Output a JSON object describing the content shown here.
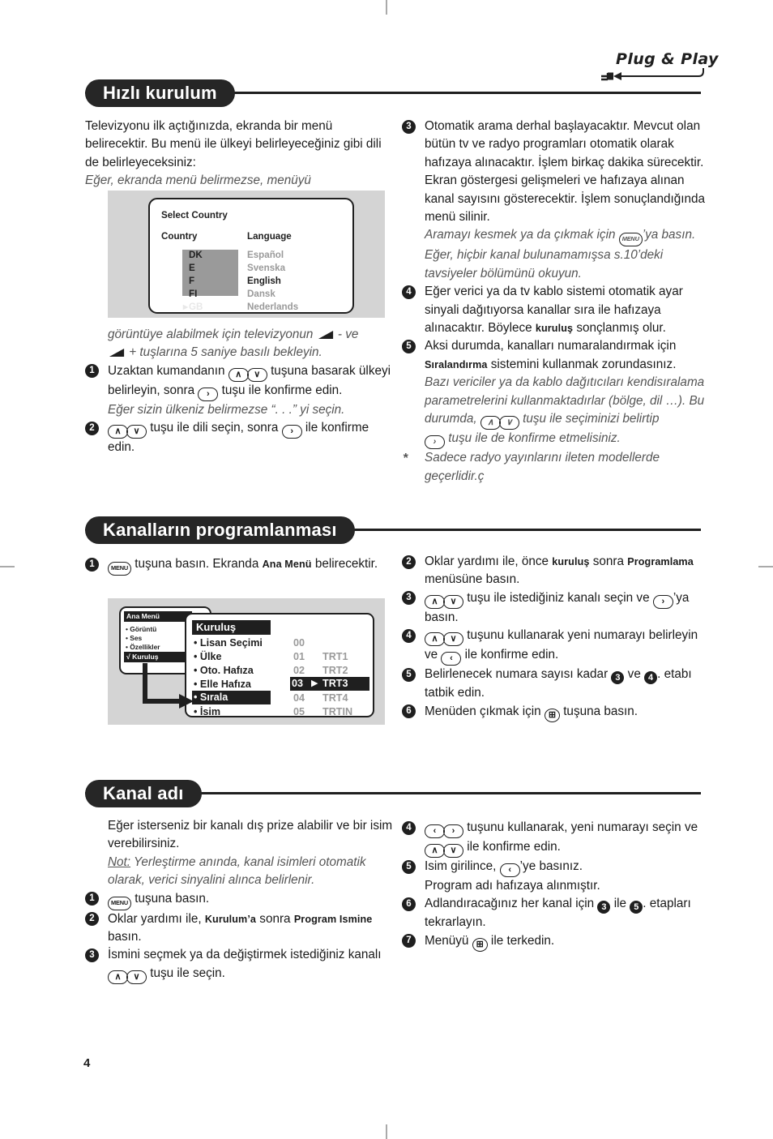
{
  "logo": {
    "text": "Plug & Play"
  },
  "page_number": "4",
  "sections": {
    "quick_install": {
      "title": "Hızlı kurulum",
      "left": {
        "intro": "Televizyonu ilk açtığınızda, ekranda bir menü belirecektir. Bu menü ile ülkeyi belirleyeceğiniz gibi dili de belirleyeceksiniz:",
        "intro_italic": "Eğer, ekranda menü belirmezse, menüyü",
        "after_shot_italic_1": "görüntüye alabilmek için televizyonun",
        "after_shot_italic_1b": "- ve",
        "after_shot_italic_2": "+ tuşlarına 5 saniye basılı bekleyin.",
        "step1_a": "Uzaktan kumandanın",
        "step1_b": "tuşuna basarak ülkeyi belirleyin, sonra",
        "step1_c": "tuşu ile konfirme edin.",
        "step1_note": "Eğer sizin ülkeniz belirmezse “. . .” yi seçin.",
        "step2_a": "tuşu ile dili seçin, sonra",
        "step2_b": "ile konfirme edin."
      },
      "osd_select_country": {
        "title": "Select Country",
        "col_country": "Country",
        "col_language": "Language",
        "countries": [
          "DK",
          "E",
          "F",
          "FI",
          "GB"
        ],
        "selected_country": "GB",
        "languages": [
          "Español",
          "Svenska",
          "English",
          "Dansk",
          "Nederlands"
        ],
        "selected_language": "English"
      },
      "right": {
        "step3_text": "Otomatik arama derhal başlayacaktır. Mevcut olan bütün tv ve radyo programları otomatik olarak hafızaya alınacaktır. İşlem birkaç dakika sürecektir. Ekran göstergesi gelişmeleri ve hafızaya alınan kanal sayısını gösterecektir. İşlem sonuçlandığında menü silinir.",
        "step3_note_a": "Aramayı kesmek ya da çıkmak için",
        "step3_note_b": "’ya basın. Eğer, hiçbir kanal bulunamamışsa s.10’deki tavsiyeler bölümünü okuyun.",
        "step4_a": "Eğer verici ya da tv kablo sistemi otomatik ayar sinyali dağıtıyorsa kanallar sıra ile hafızaya alınacaktır. Böylece",
        "step4_bold": "kuruluş",
        "step4_b": "sonçlanmış olur.",
        "step5_a": "Aksi durumda, kanalları numaralandırmak için",
        "step5_bold": "Sıralandırma",
        "step5_b": "sistemini kullanmak zorundasınız.",
        "step5_note_a": "Bazı vericiler ya da kablo dağıtıcıları kendisıralama parametrelerini kullanmaktadırlar (bölge, dil …). Bu durumda,",
        "step5_note_b": "tuşu ile seçiminizi belirtip",
        "step5_note_c": "tuşu ile de konfirme etmelisiniz.",
        "footnote_mark": "*",
        "footnote": "Sadece radyo yayınlarını ileten modellerde geçerlidir.ç"
      }
    },
    "channel_programming": {
      "title": "Kanalların programlanması",
      "left": {
        "step1_a": "tuşuna basın. Ekranda",
        "step1_bold": "Ana Menü",
        "step1_b": "belirecektir."
      },
      "osd_main_menu": {
        "title": "Ana Menü",
        "items": [
          "Görüntü",
          "Ses",
          "Özellikler"
        ],
        "selected": "Kuruluş",
        "selected_prefix": "√"
      },
      "osd_setup": {
        "title": "Kuruluş",
        "items": [
          "Lisan Seçimi",
          "Ülke",
          "Oto. Hafıza",
          "Elle Hafıza",
          "Sırala",
          "İsim"
        ],
        "highlighted": "Sırala",
        "channels": [
          {
            "num": "00",
            "name": ""
          },
          {
            "num": "01",
            "name": "TRT1"
          },
          {
            "num": "02",
            "name": "TRT2"
          },
          {
            "num": "03",
            "name": "TRT3"
          },
          {
            "num": "04",
            "name": "TRT4"
          },
          {
            "num": "05",
            "name": "TRTIN"
          }
        ],
        "highlighted_channel": "03"
      },
      "right": {
        "step2_a": "Oklar yardımı ile, önce",
        "step2_bold1": "kuruluş",
        "step2_b": "sonra",
        "step2_bold2": "Programlama",
        "step2_c": "menüsüne basın.",
        "step3_a": "tuşu ile istediğiniz kanalı seçin ve",
        "step3_b": "’ya basın.",
        "step4_a": "tuşunu kullanarak yeni numarayı belirleyin ve",
        "step4_b": "ile konfirme edin.",
        "step5_a": "Belirlenecek numara sayısı kadar",
        "step5_mid": "ve",
        "step5_b": ". etabı tatbik edin.",
        "step6_a": "Menüden çıkmak için",
        "step6_b": "tuşuna basın."
      }
    },
    "channel_name": {
      "title": "Kanal adı",
      "left": {
        "intro": "Eğer isterseniz bir kanalı dış prize alabilir ve bir isim verebilirsiniz.",
        "note_label": "Not:",
        "note_text": "Yerleştirme anında, kanal isimleri otomatik olarak, verici sinyalini alınca belirlenir.",
        "step1": "tuşuna basın.",
        "step2_a": "Oklar yardımı ile,",
        "step2_bold1": "Kurulum’a",
        "step2_b": "sonra",
        "step2_bold2": "Program Ismine",
        "step2_c": "basın.",
        "step3_a": "İsmini seçmek ya da değiştirmek istediğiniz kanalı",
        "step3_b": "tuşu ile seçin."
      },
      "right": {
        "step4_a": "tuşunu kullanarak, yeni numarayı seçin ve",
        "step4_b": "ile konfirme edin.",
        "step5_a": "Isim girilince,",
        "step5_b": "’ye basınız.",
        "step5_c": "Program adı hafızaya alınmıştır.",
        "step6_a": "Adlandıracağınız her kanal için",
        "step6_mid": "ile",
        "step6_b": ". etapları tekrarlayın.",
        "step7_a": "Menüyü",
        "step7_b": "ile terkedin."
      }
    }
  },
  "keys": {
    "up": "∧",
    "down": "∨",
    "right": "›",
    "left": "‹",
    "menu": "MENU",
    "exit": "⊞"
  }
}
